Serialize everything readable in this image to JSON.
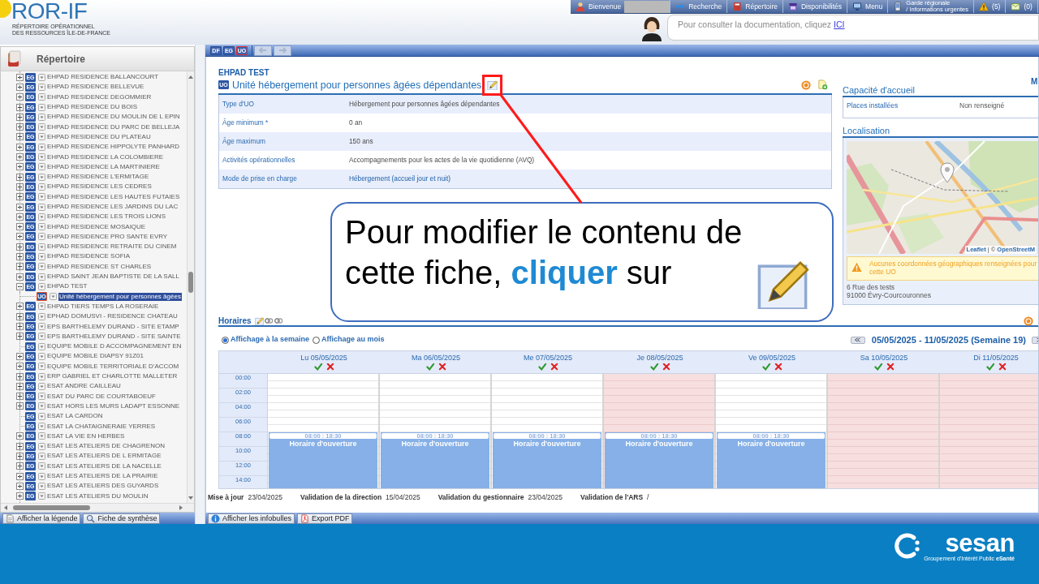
{
  "header": {
    "logo": {
      "title": "ROR-IF",
      "subtitle": [
        "RÉPERTOIRE OPÉRATIONNEL",
        "DES RESSOURCES ÎLE-DE-FRANCE"
      ]
    },
    "nav": [
      {
        "kind": "user",
        "label": "Bienvenue"
      },
      {
        "kind": "search",
        "label": "Recherche"
      },
      {
        "kind": "directory",
        "label": "Répertoire"
      },
      {
        "kind": "availability",
        "label": "Disponibilités"
      },
      {
        "kind": "menu",
        "label": "Menu"
      },
      {
        "kind": "duty",
        "label": "Garde régionale\n/ Informations urgentes"
      },
      {
        "kind": "alerts",
        "label": "(5)"
      },
      {
        "kind": "messages",
        "label": "(0)"
      }
    ],
    "help": {
      "text": "Pour consulter la documentation, cliquez",
      "link": "ICI"
    }
  },
  "toolbar": {
    "types": [
      {
        "label": "DF",
        "selected": false
      },
      {
        "label": "EG",
        "selected": false
      },
      {
        "label": "UO",
        "selected": true
      }
    ],
    "history": [
      {
        "kind": "back",
        "disabled": true
      },
      {
        "kind": "forward",
        "disabled": true
      }
    ]
  },
  "sidebar": {
    "title": "Répertoire",
    "items": [
      {
        "badge": "EG",
        "label": "EHPAD RESIDENCE BALLANCOURT",
        "expandable": true,
        "expanded": false,
        "selected": false
      },
      {
        "badge": "EG",
        "label": "EHPAD RESIDENCE BELLEVUE",
        "expandable": true,
        "expanded": false,
        "selected": false
      },
      {
        "badge": "EG",
        "label": "EHPAD RESIDENCE DEGOMMIER",
        "expandable": true,
        "expanded": false,
        "selected": false
      },
      {
        "badge": "EG",
        "label": "EHPAD RESIDENCE DU BOIS",
        "expandable": true,
        "expanded": false,
        "selected": false
      },
      {
        "badge": "EG",
        "label": "EHPAD RESIDENCE DU MOULIN DE L EPIN",
        "expandable": true,
        "expanded": false,
        "selected": false
      },
      {
        "badge": "EG",
        "label": "EHPAD RESIDENCE DU PARC DE BELLEJA",
        "expandable": true,
        "expanded": false,
        "selected": false
      },
      {
        "badge": "EG",
        "label": "EHPAD RESIDENCE DU PLATEAU",
        "expandable": true,
        "expanded": false,
        "selected": false
      },
      {
        "badge": "EG",
        "label": "EHPAD RESIDENCE HIPPOLYTE PANHARD",
        "expandable": true,
        "expanded": false,
        "selected": false
      },
      {
        "badge": "EG",
        "label": "EHPAD RESIDENCE LA COLOMBIERE",
        "expandable": true,
        "expanded": false,
        "selected": false
      },
      {
        "badge": "EG",
        "label": "EHPAD RESIDENCE LA MARTINIERE",
        "expandable": true,
        "expanded": false,
        "selected": false
      },
      {
        "badge": "EG",
        "label": "EHPAD RESIDENCE L'ERMITAGE",
        "expandable": true,
        "expanded": false,
        "selected": false
      },
      {
        "badge": "EG",
        "label": "EHPAD RESIDENCE LES CEDRES",
        "expandable": true,
        "expanded": false,
        "selected": false
      },
      {
        "badge": "EG",
        "label": "EHPAD RESIDENCE LES HAUTES FUTAIES",
        "expandable": true,
        "expanded": false,
        "selected": false
      },
      {
        "badge": "EG",
        "label": "EHPAD RESIDENCE LES JARDINS DU LAC",
        "expandable": true,
        "expanded": false,
        "selected": false
      },
      {
        "badge": "EG",
        "label": "EHPAD RESIDENCE LES TROIS LIONS",
        "expandable": true,
        "expanded": false,
        "selected": false
      },
      {
        "badge": "EG",
        "label": "EHPAD RESIDENCE MOSAIQUE",
        "expandable": true,
        "expanded": false,
        "selected": false
      },
      {
        "badge": "EG",
        "label": "EHPAD RESIDENCE PRO SANTE EVRY",
        "expandable": true,
        "expanded": false,
        "selected": false
      },
      {
        "badge": "EG",
        "label": "EHPAD RESIDENCE RETRAITE DU CINEM",
        "expandable": true,
        "expanded": false,
        "selected": false
      },
      {
        "badge": "EG",
        "label": "EHPAD RESIDENCE SOFIA",
        "expandable": true,
        "expanded": false,
        "selected": false
      },
      {
        "badge": "EG",
        "label": "EHPAD RESIDENCE ST CHARLES",
        "expandable": true,
        "expanded": false,
        "selected": false
      },
      {
        "badge": "EG",
        "label": "EHPAD SAINT JEAN BAPTISTE DE LA SALL",
        "expandable": true,
        "expanded": false,
        "selected": false
      },
      {
        "badge": "EG",
        "label": "EHPAD TEST",
        "expandable": true,
        "expanded": true,
        "selected": false,
        "children": [
          {
            "badge": "UO",
            "label": "Unité hébergement pour personnes âgées",
            "selected": true
          }
        ]
      },
      {
        "badge": "EG",
        "label": "EHPAD TIERS TEMPS LA ROSERAIE",
        "expandable": true,
        "expanded": false,
        "selected": false
      },
      {
        "badge": "EG",
        "label": "EPHAD DOMUSVI - RESIDENCE CHATEAU",
        "expandable": true,
        "expanded": false,
        "selected": false
      },
      {
        "badge": "EG",
        "label": "EPS BARTHELEMY DURAND - SITE ETAMP",
        "expandable": true,
        "expanded": false,
        "selected": false
      },
      {
        "badge": "EG",
        "label": "EPS BARTHELEMY DURAND - SITE SAINTE",
        "expandable": true,
        "expanded": false,
        "selected": false
      },
      {
        "badge": "EG",
        "label": "EQUIPE MOBILE D ACCOMPAGNEMENT EN",
        "expandable": false,
        "selected": false
      },
      {
        "badge": "EG",
        "label": "EQUIPE MOBILE DIAPSY 91Z01",
        "expandable": true,
        "expanded": false,
        "selected": false
      },
      {
        "badge": "EG",
        "label": "EQUIPE MOBILE TERRITORIALE D'ACCOM",
        "expandable": true,
        "expanded": false,
        "selected": false
      },
      {
        "badge": "EG",
        "label": "ERP GABRIEL ET CHARLOTTE MALLETER",
        "expandable": true,
        "expanded": false,
        "selected": false
      },
      {
        "badge": "EG",
        "label": "ESAT ANDRE CAILLEAU",
        "expandable": true,
        "expanded": false,
        "selected": false
      },
      {
        "badge": "EG",
        "label": "ESAT DU PARC DE COURTABOEUF",
        "expandable": true,
        "expanded": false,
        "selected": false
      },
      {
        "badge": "EG",
        "label": "ESAT HORS LES MURS LADAPT ESSONNE",
        "expandable": true,
        "expanded": false,
        "selected": false
      },
      {
        "badge": "EG",
        "label": "ESAT LA CARDON",
        "expandable": false,
        "selected": false
      },
      {
        "badge": "EG",
        "label": "ESAT LA CHATAIGNERAIE YERRES",
        "expandable": false,
        "selected": false
      },
      {
        "badge": "EG",
        "label": "ESAT LA VIE EN HERBES",
        "expandable": true,
        "expanded": false,
        "selected": false
      },
      {
        "badge": "EG",
        "label": "ESAT LES ATELIERS DE CHAGRENON",
        "expandable": true,
        "expanded": false,
        "selected": false
      },
      {
        "badge": "EG",
        "label": "ESAT LES ATELIERS DE L ERMITAGE",
        "expandable": true,
        "expanded": false,
        "selected": false
      },
      {
        "badge": "EG",
        "label": "ESAT LES ATELIERS DE LA NACELLE",
        "expandable": true,
        "expanded": false,
        "selected": false
      },
      {
        "badge": "EG",
        "label": "ESAT LES ATELIERS DE LA PRAIRIE",
        "expandable": true,
        "expanded": false,
        "selected": false
      },
      {
        "badge": "EG",
        "label": "ESAT LES ATELIERS DES GUYARDS",
        "expandable": true,
        "expanded": false,
        "selected": false
      },
      {
        "badge": "EG",
        "label": "ESAT LES ATELIERS DU MOULIN",
        "expandable": true,
        "expanded": false,
        "selected": false
      }
    ],
    "buttons": [
      {
        "kind": "legend",
        "label": "Afficher la légende"
      },
      {
        "kind": "summary",
        "label": "Fiche de synthèse"
      }
    ]
  },
  "detail": {
    "parent": "EHPAD TEST",
    "badge": "UO",
    "title": "Unité hébergement pour personnes âgées dépendantes",
    "fields": [
      {
        "label": "Type d'UO",
        "value": "Hébergement pour personnes âgées dépendantes",
        "kind": "text"
      },
      {
        "label": "Âge minimum *",
        "value": "0 an",
        "kind": "text"
      },
      {
        "label": "Âge maximum",
        "value": "150 ans",
        "kind": "text"
      },
      {
        "label": "Activités opérationnelles",
        "value": "Accompagnements pour les actes de la vie quotidienne (AVQ)",
        "kind": "text"
      },
      {
        "label": "Mode de prise en charge",
        "value": "Hébergement (accueil jour et nuit)",
        "kind": "link"
      }
    ]
  },
  "side_panel": {
    "corner_link": "M",
    "capacity": {
      "title": "Capacité d'accueil",
      "rows": [
        {
          "label": "Places installées",
          "value": "Non renseigné"
        }
      ]
    },
    "location": {
      "title": "Localisation",
      "attribution": {
        "link": "Leaflet",
        "separator": "| ©",
        "source": "OpenStreetM"
      },
      "warning": "Aucunes coordonnées géographiques renseignées pour cette UO",
      "address": [
        "6 Rue des tests",
        "91000 Évry-Courcouronnes"
      ]
    }
  },
  "callout": {
    "text": "Pour modifier le contenu de cette fiche, **cliquer** sur"
  },
  "schedule": {
    "title": "Horaires",
    "views": [
      {
        "label": "Affichage à la semaine",
        "selected": true
      },
      {
        "label": "Affichage au mois",
        "selected": false
      }
    ],
    "week": "05/05/2025 - 11/05/2025 (Semaine 19)",
    "hours": [
      "00:00",
      "02:00",
      "04:00",
      "06:00",
      "08:00",
      "10:00",
      "12:00",
      "14:00"
    ],
    "days": [
      {
        "label": "Lu 05/05/2025",
        "non_working": false,
        "slots": [
          {
            "time": "08:00 : 18:30",
            "label": "Horaire d'ouverture"
          }
        ]
      },
      {
        "label": "Ma 06/05/2025",
        "non_working": false,
        "slots": [
          {
            "time": "08:00 : 18:30",
            "label": "Horaire d'ouverture"
          }
        ]
      },
      {
        "label": "Me 07/05/2025",
        "non_working": false,
        "slots": [
          {
            "time": "08:00 : 18:30",
            "label": "Horaire d'ouverture"
          }
        ]
      },
      {
        "label": "Je 08/05/2025",
        "non_working": true,
        "slots": [
          {
            "time": "08:00 : 18:30",
            "label": "Horaire d'ouverture"
          }
        ]
      },
      {
        "label": "Ve 09/05/2025",
        "non_working": false,
        "slots": [
          {
            "time": "08:00 : 18:30",
            "label": "Horaire d'ouverture"
          }
        ]
      },
      {
        "label": "Sa 10/05/2025",
        "non_working": true
      },
      {
        "label": "Di 11/05/2025",
        "non_working": true
      }
    ]
  },
  "footer_meta": [
    {
      "label": "Mise à jour",
      "value": "23/04/2025"
    },
    {
      "label": "Validation de la direction",
      "value": "15/04/2025"
    },
    {
      "label": "Validation du gestionnaire",
      "value": "23/04/2025"
    },
    {
      "label": "Validation de l'ARS",
      "value": "/"
    }
  ],
  "bottom_toolbar": [
    {
      "kind": "tooltips",
      "label": "Afficher les infobulles"
    },
    {
      "kind": "pdf",
      "label": "Export PDF"
    }
  ],
  "brand": {
    "name": "sesan",
    "tagline": "Groupement d'Intérêt Public **eSanté**"
  }
}
